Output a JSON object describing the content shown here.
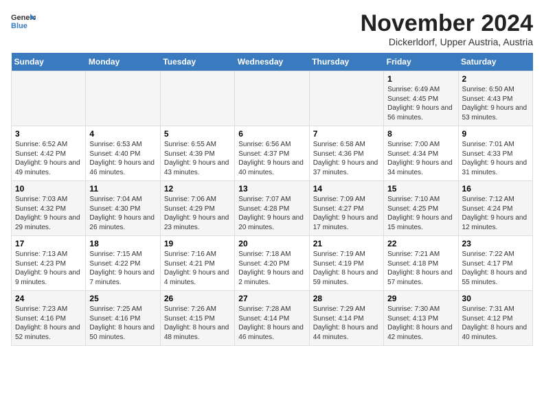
{
  "header": {
    "logo_line1": "General",
    "logo_line2": "Blue",
    "month": "November 2024",
    "location": "Dickerldorf, Upper Austria, Austria"
  },
  "days_of_week": [
    "Sunday",
    "Monday",
    "Tuesday",
    "Wednesday",
    "Thursday",
    "Friday",
    "Saturday"
  ],
  "weeks": [
    [
      {
        "day": "",
        "info": ""
      },
      {
        "day": "",
        "info": ""
      },
      {
        "day": "",
        "info": ""
      },
      {
        "day": "",
        "info": ""
      },
      {
        "day": "",
        "info": ""
      },
      {
        "day": "1",
        "info": "Sunrise: 6:49 AM\nSunset: 4:45 PM\nDaylight: 9 hours and 56 minutes."
      },
      {
        "day": "2",
        "info": "Sunrise: 6:50 AM\nSunset: 4:43 PM\nDaylight: 9 hours and 53 minutes."
      }
    ],
    [
      {
        "day": "3",
        "info": "Sunrise: 6:52 AM\nSunset: 4:42 PM\nDaylight: 9 hours and 49 minutes."
      },
      {
        "day": "4",
        "info": "Sunrise: 6:53 AM\nSunset: 4:40 PM\nDaylight: 9 hours and 46 minutes."
      },
      {
        "day": "5",
        "info": "Sunrise: 6:55 AM\nSunset: 4:39 PM\nDaylight: 9 hours and 43 minutes."
      },
      {
        "day": "6",
        "info": "Sunrise: 6:56 AM\nSunset: 4:37 PM\nDaylight: 9 hours and 40 minutes."
      },
      {
        "day": "7",
        "info": "Sunrise: 6:58 AM\nSunset: 4:36 PM\nDaylight: 9 hours and 37 minutes."
      },
      {
        "day": "8",
        "info": "Sunrise: 7:00 AM\nSunset: 4:34 PM\nDaylight: 9 hours and 34 minutes."
      },
      {
        "day": "9",
        "info": "Sunrise: 7:01 AM\nSunset: 4:33 PM\nDaylight: 9 hours and 31 minutes."
      }
    ],
    [
      {
        "day": "10",
        "info": "Sunrise: 7:03 AM\nSunset: 4:32 PM\nDaylight: 9 hours and 29 minutes."
      },
      {
        "day": "11",
        "info": "Sunrise: 7:04 AM\nSunset: 4:30 PM\nDaylight: 9 hours and 26 minutes."
      },
      {
        "day": "12",
        "info": "Sunrise: 7:06 AM\nSunset: 4:29 PM\nDaylight: 9 hours and 23 minutes."
      },
      {
        "day": "13",
        "info": "Sunrise: 7:07 AM\nSunset: 4:28 PM\nDaylight: 9 hours and 20 minutes."
      },
      {
        "day": "14",
        "info": "Sunrise: 7:09 AM\nSunset: 4:27 PM\nDaylight: 9 hours and 17 minutes."
      },
      {
        "day": "15",
        "info": "Sunrise: 7:10 AM\nSunset: 4:25 PM\nDaylight: 9 hours and 15 minutes."
      },
      {
        "day": "16",
        "info": "Sunrise: 7:12 AM\nSunset: 4:24 PM\nDaylight: 9 hours and 12 minutes."
      }
    ],
    [
      {
        "day": "17",
        "info": "Sunrise: 7:13 AM\nSunset: 4:23 PM\nDaylight: 9 hours and 9 minutes."
      },
      {
        "day": "18",
        "info": "Sunrise: 7:15 AM\nSunset: 4:22 PM\nDaylight: 9 hours and 7 minutes."
      },
      {
        "day": "19",
        "info": "Sunrise: 7:16 AM\nSunset: 4:21 PM\nDaylight: 9 hours and 4 minutes."
      },
      {
        "day": "20",
        "info": "Sunrise: 7:18 AM\nSunset: 4:20 PM\nDaylight: 9 hours and 2 minutes."
      },
      {
        "day": "21",
        "info": "Sunrise: 7:19 AM\nSunset: 4:19 PM\nDaylight: 8 hours and 59 minutes."
      },
      {
        "day": "22",
        "info": "Sunrise: 7:21 AM\nSunset: 4:18 PM\nDaylight: 8 hours and 57 minutes."
      },
      {
        "day": "23",
        "info": "Sunrise: 7:22 AM\nSunset: 4:17 PM\nDaylight: 8 hours and 55 minutes."
      }
    ],
    [
      {
        "day": "24",
        "info": "Sunrise: 7:23 AM\nSunset: 4:16 PM\nDaylight: 8 hours and 52 minutes."
      },
      {
        "day": "25",
        "info": "Sunrise: 7:25 AM\nSunset: 4:16 PM\nDaylight: 8 hours and 50 minutes."
      },
      {
        "day": "26",
        "info": "Sunrise: 7:26 AM\nSunset: 4:15 PM\nDaylight: 8 hours and 48 minutes."
      },
      {
        "day": "27",
        "info": "Sunrise: 7:28 AM\nSunset: 4:14 PM\nDaylight: 8 hours and 46 minutes."
      },
      {
        "day": "28",
        "info": "Sunrise: 7:29 AM\nSunset: 4:14 PM\nDaylight: 8 hours and 44 minutes."
      },
      {
        "day": "29",
        "info": "Sunrise: 7:30 AM\nSunset: 4:13 PM\nDaylight: 8 hours and 42 minutes."
      },
      {
        "day": "30",
        "info": "Sunrise: 7:31 AM\nSunset: 4:12 PM\nDaylight: 8 hours and 40 minutes."
      }
    ]
  ]
}
